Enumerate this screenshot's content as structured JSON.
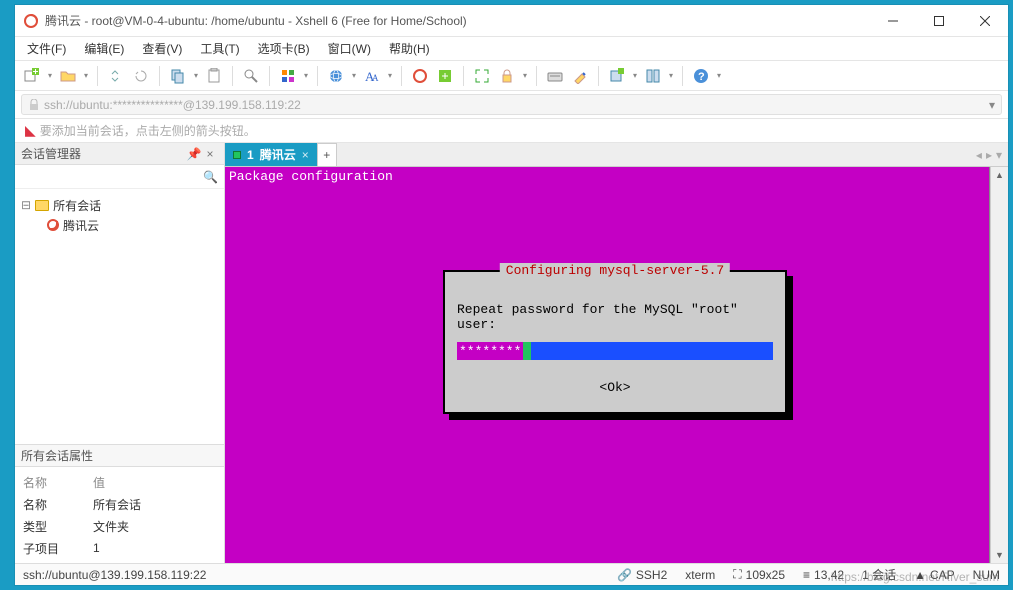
{
  "titlebar": {
    "title": "腾讯云 - root@VM-0-4-ubuntu: /home/ubuntu - Xshell 6 (Free for Home/School)"
  },
  "menubar": {
    "items": [
      "文件(F)",
      "编辑(E)",
      "查看(V)",
      "工具(T)",
      "选项卡(B)",
      "窗口(W)",
      "帮助(H)"
    ]
  },
  "addressbar": {
    "url": "ssh://ubuntu:***************@139.199.158.119:22"
  },
  "hintbar": {
    "text": "要添加当前会话，点击左侧的箭头按钮。"
  },
  "sidebar": {
    "title": "会话管理器",
    "tree": {
      "root": "所有会话",
      "items": [
        "腾讯云"
      ]
    },
    "propsTitle": "所有会话属性",
    "propsHeader": {
      "name": "名称",
      "value": "值"
    },
    "props": [
      {
        "k": "名称",
        "v": "所有会话"
      },
      {
        "k": "类型",
        "v": "文件夹"
      },
      {
        "k": "子项目",
        "v": "1"
      }
    ]
  },
  "tabs": {
    "active": {
      "index": "1",
      "label": "腾讯云"
    }
  },
  "terminal": {
    "header": "Package configuration",
    "dialog": {
      "title": "Configuring mysql-server-5.7",
      "prompt": "Repeat password for the MySQL \"root\" user:",
      "password": "********",
      "ok": "<Ok>"
    }
  },
  "statusbar": {
    "conn": "ssh://ubuntu@139.199.158.119:22",
    "proto": "SSH2",
    "termtype": "xterm",
    "size": "109x25",
    "pos": "13,42",
    "sessions": "1 会话",
    "caps": "CAP",
    "num": "NUM"
  },
  "watermark": "https://blog.csdn.net/River_sum"
}
